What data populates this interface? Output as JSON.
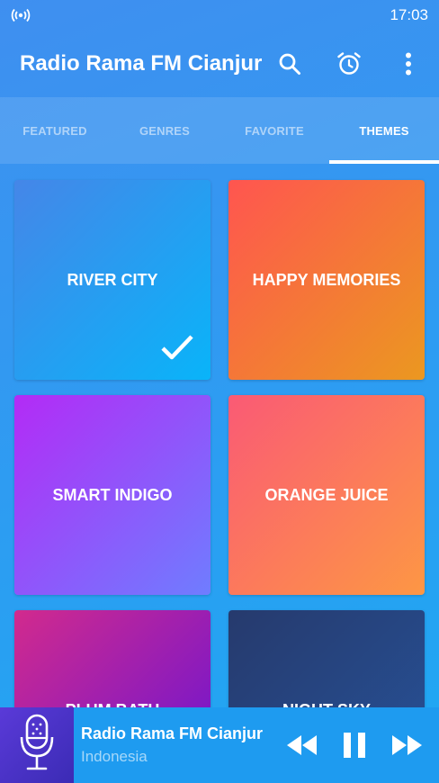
{
  "statusbar": {
    "time": "17:03",
    "icon": "radio-broadcast-icon"
  },
  "appbar": {
    "title": "Radio Rama FM Cianjur",
    "actions": [
      "search-icon",
      "alarm-clock-icon",
      "more-vert-icon"
    ]
  },
  "tabs": [
    {
      "label": "FEATURED",
      "active": false
    },
    {
      "label": "GENRES",
      "active": false
    },
    {
      "label": "FAVORITE",
      "active": false
    },
    {
      "label": "THEMES",
      "active": true
    }
  ],
  "themes": [
    {
      "name": "RIVER CITY",
      "selected": true,
      "colors": [
        "#4586e8",
        "#09b4f9"
      ]
    },
    {
      "name": "HAPPY MEMORIES",
      "selected": false,
      "colors": [
        "#ff5550",
        "#eb9820"
      ]
    },
    {
      "name": "SMART INDIGO",
      "selected": false,
      "colors": [
        "#b32bf6",
        "#6f7dff"
      ]
    },
    {
      "name": "ORANGE JUICE",
      "selected": false,
      "colors": [
        "#fa5a75",
        "#fd9744"
      ]
    },
    {
      "name": "PLUM BATH",
      "selected": false,
      "colors": [
        "#d22a8d",
        "#6313d7"
      ]
    },
    {
      "name": "NIGHT SKY",
      "selected": false,
      "colors": [
        "#263a6d",
        "#27539a"
      ]
    }
  ],
  "player": {
    "station": "Radio Rama FM Cianjur",
    "country": "Indonesia",
    "controls": [
      "rewind-icon",
      "pause-icon",
      "fast-forward-icon"
    ]
  }
}
